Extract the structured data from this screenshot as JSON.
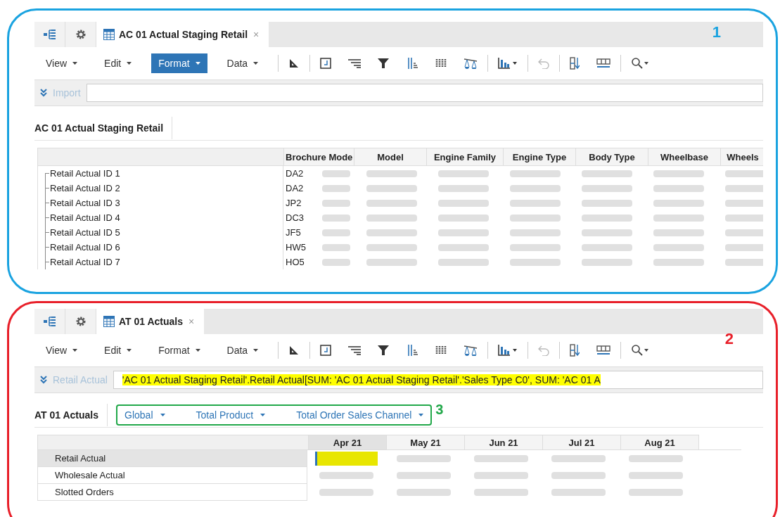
{
  "panels": [
    {
      "callout": "1",
      "color": "#1aa3e0",
      "tab": {
        "title": "AC 01 Actual Staging Retail",
        "close": "×",
        "selected": true
      },
      "menus": [
        {
          "label": "View",
          "selected": false
        },
        {
          "label": "Edit",
          "selected": false
        },
        {
          "label": "Format",
          "selected": true
        },
        {
          "label": "Data",
          "selected": false
        }
      ],
      "formula": {
        "label": "Import"
      },
      "sheet_tab": "AC 01 Actual Staging Retail",
      "grid": {
        "kind": "rows",
        "columns": [
          "Brochure Mode",
          "Model",
          "Engine Family",
          "Engine Type",
          "Body Type",
          "Wheelbase",
          "Wheels"
        ],
        "rows": [
          {
            "label": "Retail Actual ID 1",
            "cell": "DA2",
            "selected": false
          },
          {
            "label": "Retail Actual ID 2",
            "cell": "DA2",
            "selected": false
          },
          {
            "label": "Retail Actual ID 3",
            "cell": "JP2",
            "selected": false
          },
          {
            "label": "Retail Actual ID 4",
            "cell": "DC3",
            "selected": false
          },
          {
            "label": "Retail Actual ID 5",
            "cell": "JF5",
            "selected": false
          },
          {
            "label": "Retail Actual ID 6",
            "cell": "HW5",
            "selected": false
          },
          {
            "label": "Retail Actual ID 7",
            "cell": "HO5",
            "selected": false
          }
        ]
      }
    },
    {
      "callout": "2",
      "color": "#e8202a",
      "tab": {
        "title": "AT 01 Actuals",
        "close": "×",
        "selected": true
      },
      "menus": [
        {
          "label": "View",
          "selected": false
        },
        {
          "label": "Edit",
          "selected": false
        },
        {
          "label": "Format",
          "selected": false
        },
        {
          "label": "Data",
          "selected": false
        }
      ],
      "formula": {
        "label": "Retail Actual",
        "value": "'AC 01 Actual Staging Retail'.Retail Actual[SUM: 'AC 01 Actual Staging Retail'.'Sales Type C0', SUM: 'AC 01 A",
        "highlighted": true
      },
      "sheet_tab": "AT 01 Actuals",
      "filters": {
        "callout": "3",
        "color": "#22a84a",
        "items": [
          "Global",
          "Total Product",
          "Total Order Sales Channel"
        ]
      },
      "grid": {
        "kind": "months",
        "columns": [
          "Apr 21",
          "May 21",
          "Jun 21",
          "Jul 21",
          "Aug 21"
        ],
        "rows": [
          {
            "label": "Retail Actual",
            "selected": true
          },
          {
            "label": "Wholesale Actual",
            "selected": false
          },
          {
            "label": "Slotted Orders",
            "selected": false
          }
        ]
      }
    }
  ]
}
